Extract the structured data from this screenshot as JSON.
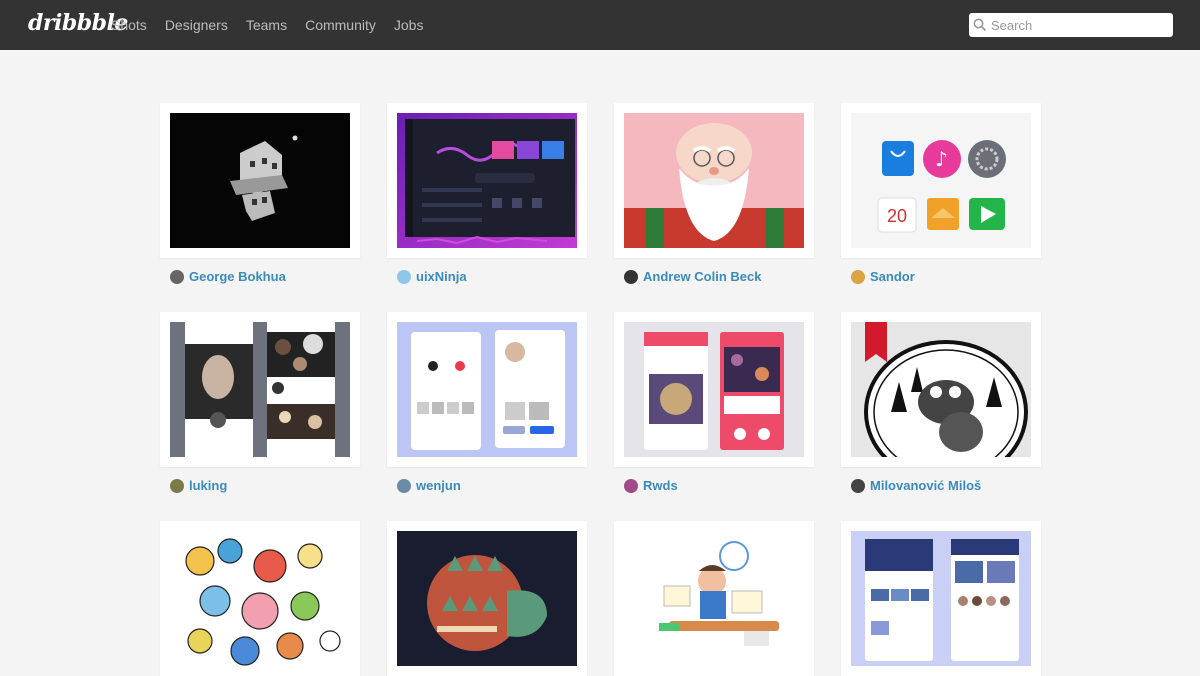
{
  "header": {
    "logo": "dribbble",
    "nav": [
      "Shots",
      "Designers",
      "Teams",
      "Community",
      "Jobs"
    ],
    "search_placeholder": "Search"
  },
  "shots": [
    {
      "author": "George Bokhua",
      "avatar_color": "#666"
    },
    {
      "author": "uixNinja",
      "avatar_color": "#8ec8e8"
    },
    {
      "author": "Andrew Colin Beck",
      "avatar_color": "#333"
    },
    {
      "author": "Sandor",
      "avatar_color": "#d9a441"
    },
    {
      "author": "luking",
      "avatar_color": "#7a7a4a"
    },
    {
      "author": "wenjun",
      "avatar_color": "#6b8aa8"
    },
    {
      "author": "Rwds",
      "avatar_color": "#a04a8a"
    },
    {
      "author": "Milovanović Miloš",
      "avatar_color": "#444"
    },
    {
      "author": "",
      "avatar_color": "#999"
    },
    {
      "author": "",
      "avatar_color": "#999"
    },
    {
      "author": "",
      "avatar_color": "#999"
    },
    {
      "author": "",
      "avatar_color": "#999"
    }
  ],
  "thumb_texts": {
    "calendar_day": "20"
  },
  "colors": {
    "topbar": "#333333",
    "link": "#3a8bbb"
  }
}
